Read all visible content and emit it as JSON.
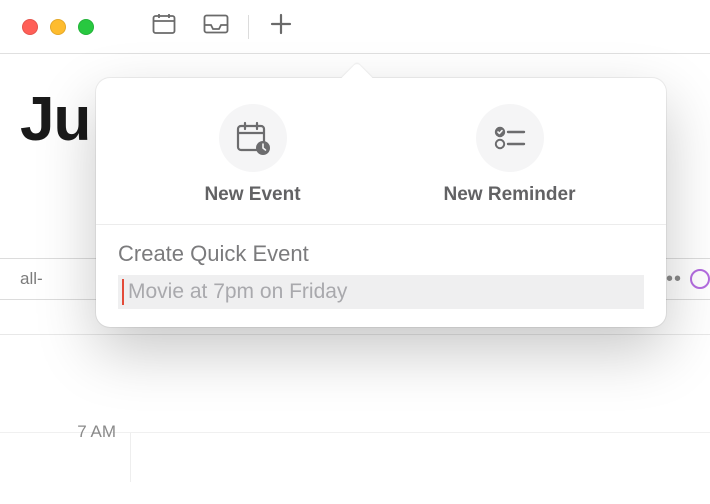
{
  "heading_partial": "Ju",
  "allday_label": "all-",
  "hour_label": "7 AM",
  "popover": {
    "new_event": "New Event",
    "new_reminder": "New Reminder",
    "quick_title": "Create Quick Event",
    "quick_placeholder": "Movie at 7pm on Friday"
  }
}
